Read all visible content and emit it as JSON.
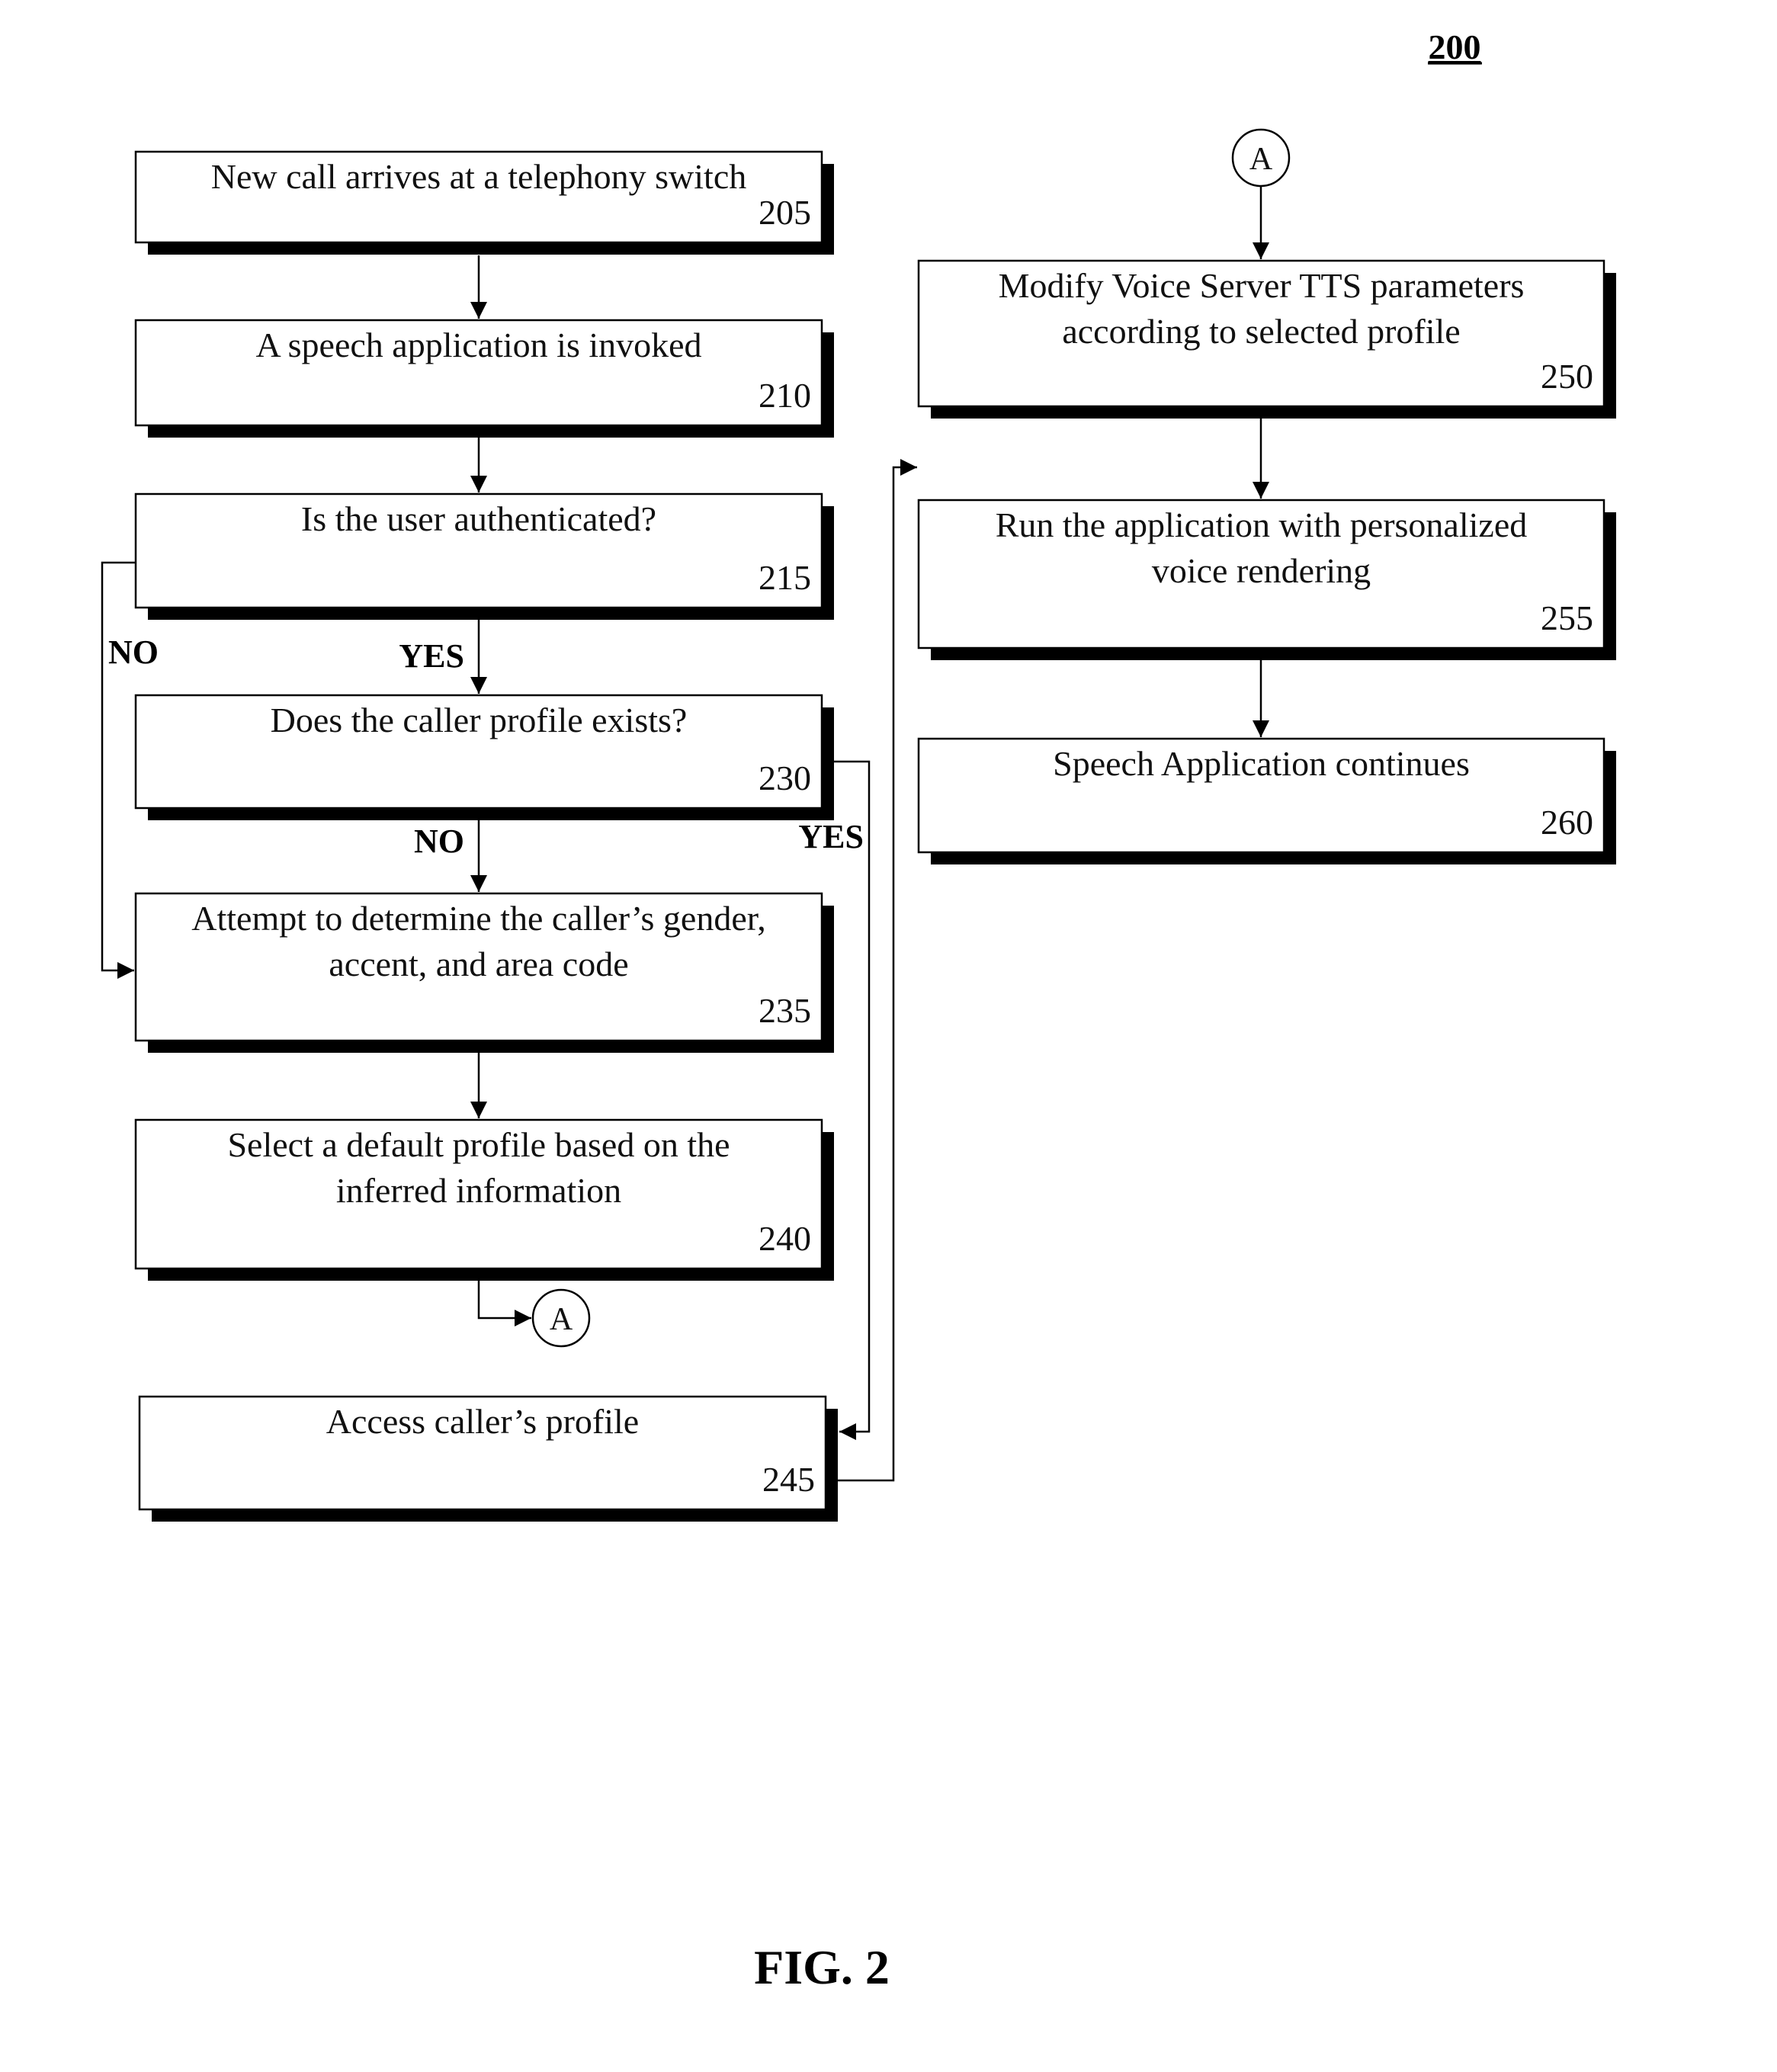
{
  "figure": {
    "reference_number": "200",
    "caption": "FIG. 2"
  },
  "steps": [
    {
      "id": "205",
      "lines": [
        "New call arrives at a telephony switch"
      ]
    },
    {
      "id": "210",
      "lines": [
        "A speech application is invoked"
      ]
    },
    {
      "id": "215",
      "lines": [
        "Is the user authenticated?"
      ]
    },
    {
      "id": "230",
      "lines": [
        "Does the caller profile exists?"
      ]
    },
    {
      "id": "235",
      "lines": [
        "Attempt to determine the caller’s gender,",
        "accent, and area code"
      ]
    },
    {
      "id": "240",
      "lines": [
        "Select a default profile based on the",
        "inferred information"
      ]
    },
    {
      "id": "245",
      "lines": [
        "Access caller’s profile"
      ]
    },
    {
      "id": "250",
      "lines": [
        "Modify Voice Server TTS parameters",
        "according to selected profile"
      ]
    },
    {
      "id": "255",
      "lines": [
        "Run the application with personalized",
        "voice rendering"
      ]
    },
    {
      "id": "260",
      "lines": [
        "Speech Application continues"
      ]
    }
  ],
  "branch_labels": {
    "auth_no": "NO",
    "auth_yes": "YES",
    "profile_no": "NO",
    "profile_yes": "YES"
  },
  "connectors": {
    "off_page_out": "A",
    "off_page_in": "A"
  },
  "edges": [
    {
      "from": "205",
      "to": "210"
    },
    {
      "from": "210",
      "to": "215"
    },
    {
      "from": "215",
      "to": "230",
      "label": "YES"
    },
    {
      "from": "215",
      "to": "235",
      "label": "NO"
    },
    {
      "from": "230",
      "to": "235",
      "label": "NO"
    },
    {
      "from": "230",
      "to": "245",
      "label": "YES"
    },
    {
      "from": "235",
      "to": "240"
    },
    {
      "from": "240",
      "to": "A"
    },
    {
      "from": "A",
      "to": "250"
    },
    {
      "from": "245",
      "to": "250"
    },
    {
      "from": "250",
      "to": "255"
    },
    {
      "from": "255",
      "to": "260"
    }
  ]
}
